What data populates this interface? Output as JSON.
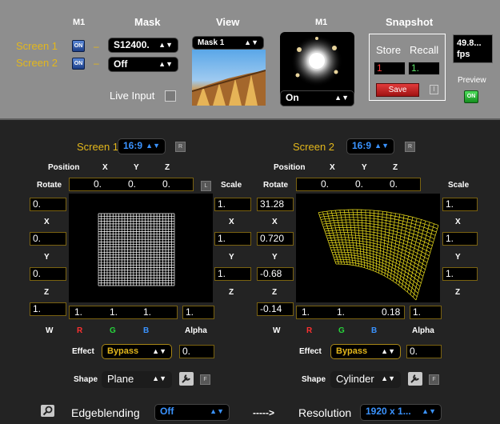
{
  "header": {
    "m1_label": "M1",
    "mask_label": "Mask",
    "view_label": "View",
    "m1_preview_label": "M1",
    "snapshot_label": "Snapshot",
    "screen1_label": "Screen 1",
    "screen2_label": "Screen 2",
    "screen1_toggle": "ON",
    "screen2_toggle": "ON",
    "dash": "–",
    "mask_screen1_value": "S12400.",
    "mask_screen2_value": "Off",
    "live_input_label": "Live Input",
    "view_select_value": "Mask 1",
    "m1_select_value": "On",
    "store_label": "Store",
    "recall_label": "Recall",
    "store_value": "1",
    "recall_value": "1.",
    "save_label": "Save",
    "fps_value": "49.8...",
    "fps_unit": "fps",
    "preview_label": "Preview",
    "preview_toggle": "ON",
    "info_icon_label": "I"
  },
  "screen1": {
    "title": "Screen 1",
    "aspect": "16:9",
    "r_button": "R",
    "l_button": "L",
    "position_label": "Position",
    "x_label": "X",
    "y_label": "Y",
    "z_label": "Z",
    "rotate_label": "Rotate",
    "scale_label": "Scale",
    "pos_x": "0.",
    "pos_y": "0.",
    "pos_z": "0.",
    "rot_0": "0.",
    "rot_x": "0.",
    "rot_y": "0.",
    "rot_z": "1.",
    "rx_label": "X",
    "ry_label": "Y",
    "rz_label": "Z",
    "scale_0": "1.",
    "scale_x": "1.",
    "scale_y": "1.",
    "scale_x_label": "X",
    "scale_y_label": "Y",
    "scale_z_label": "Z",
    "w_value": "1.",
    "r_value": "1.",
    "g_value": "1.",
    "b_value": "1.",
    "alpha_value": "1.",
    "w_label": "W",
    "r_label": "R",
    "g_label": "G",
    "b_label": "B",
    "alpha_label": "Alpha",
    "effect_label": "Effect",
    "effect_value": "Bypass",
    "effect_amount": "0.",
    "shape_label": "Shape",
    "shape_value": "Plane",
    "f_button": "F"
  },
  "screen2": {
    "title": "Screen 2",
    "aspect": "16:9",
    "r_button": "R",
    "position_label": "Position",
    "x_label": "X",
    "y_label": "Y",
    "z_label": "Z",
    "rotate_label": "Rotate",
    "scale_label": "Scale",
    "pos_x": "0.",
    "pos_y": "0.",
    "pos_z": "0.",
    "rot_0": "31.28",
    "rot_x": "0.720",
    "rot_y": "-0.68",
    "rot_z": "-0.14",
    "rx_label": "X",
    "ry_label": "Y",
    "rz_label": "Z",
    "scale_0": "1.",
    "scale_x": "1.",
    "scale_y": "1.",
    "scale_x_label": "X",
    "scale_y_label": "Y",
    "scale_z_label": "Z",
    "w_value": "1.",
    "r_value": "1.",
    "g_value": "0.18",
    "b_value": "1.",
    "alpha_value": "1.",
    "w_label": "W",
    "r_label": "R",
    "g_label": "G",
    "b_label": "B",
    "alpha_label": "Alpha",
    "effect_label": "Effect",
    "effect_value": "Bypass",
    "effect_amount": "0.",
    "shape_label": "Shape",
    "shape_value": "Cylinder",
    "f_button": "F"
  },
  "footer": {
    "edgeblending_label": "Edgeblending",
    "edgeblending_value": "Off",
    "arrow_text": "----->",
    "resolution_label": "Resolution",
    "resolution_value": "1920 x 1..."
  },
  "colors": {
    "accent_yellow": "#e3b71b",
    "accent_blue": "#3a93ff",
    "mesh_yellow": "#f0e21c",
    "top_panel": "#8e8e8e",
    "background": "#232323"
  }
}
